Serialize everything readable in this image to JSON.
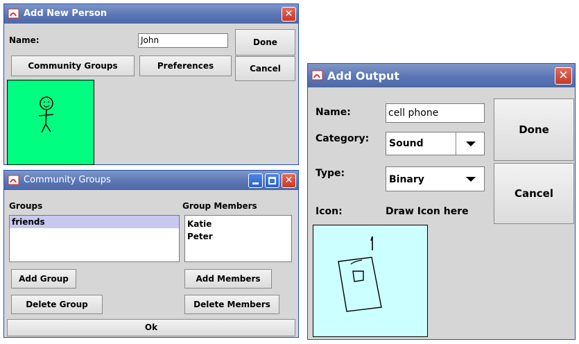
{
  "add_person": {
    "title": "Add New Person",
    "name_label": "Name:",
    "name_value": "John",
    "done_label": "Done",
    "cancel_label": "Cancel",
    "community_groups_label": "Community Groups",
    "preferences_label": "Preferences",
    "canvas_color": "#00ff80"
  },
  "community_groups": {
    "title": "Community Groups",
    "groups_header": "Groups",
    "members_header": "Group Members",
    "groups": [
      "friends"
    ],
    "members": [
      "Katie",
      "Peter"
    ],
    "add_group_label": "Add Group",
    "delete_group_label": "Delete Group",
    "add_members_label": "Add Members",
    "delete_members_label": "Delete Members",
    "ok_label": "Ok"
  },
  "add_output": {
    "title": "Add Output",
    "name_label": "Name:",
    "name_value": "cell phone",
    "category_label": "Category:",
    "category_value": "Sound",
    "type_label": "Type:",
    "type_value": "Binary",
    "icon_label": "Icon:",
    "draw_hint": "Draw Icon here",
    "done_label": "Done",
    "cancel_label": "Cancel",
    "canvas_color": "#ccffff"
  },
  "colors": {
    "titlebar": "#5b76b5",
    "selection": "#c8c8f0",
    "window_bg": "#d6d6d6"
  }
}
